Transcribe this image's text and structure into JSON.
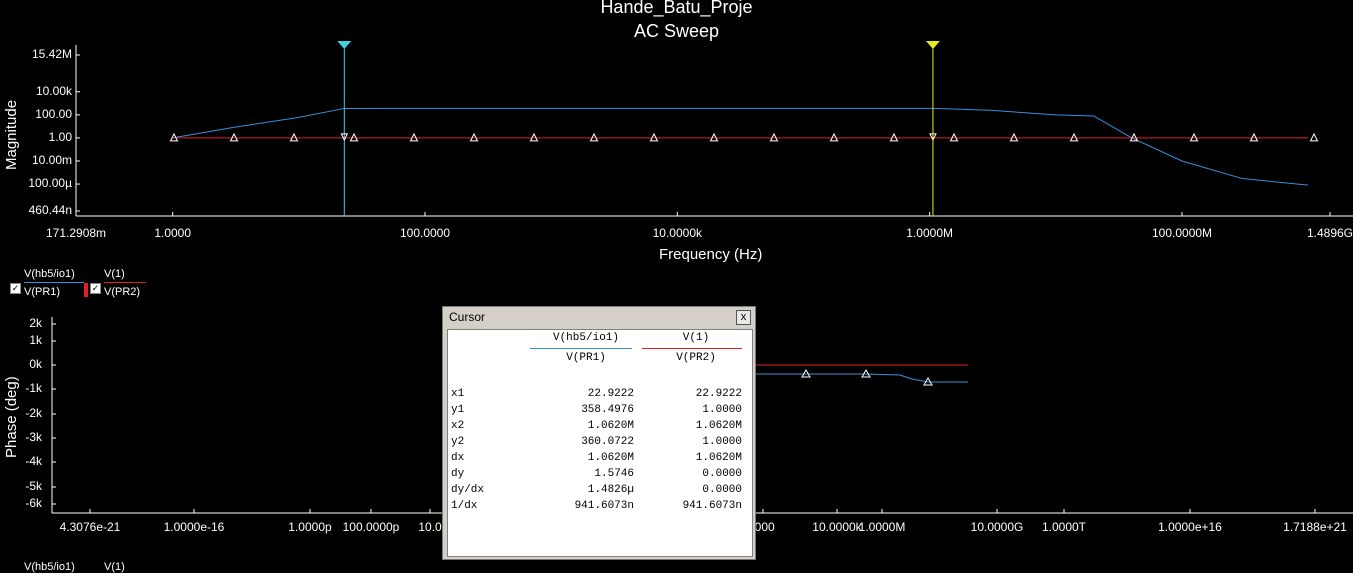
{
  "header": {
    "title": "Hande_Batu_Proje",
    "subtitle": "AC Sweep"
  },
  "colors": {
    "background": "#000000",
    "trace_blue": "#3a8fd8",
    "trace_red": "#e02020",
    "cursor1": "#40d0e0",
    "cursor2": "#e8e820"
  },
  "chart_data": [
    {
      "type": "line",
      "ylabel": "Magnitude",
      "xlabel": "Frequency (Hz)",
      "x_scale": "log",
      "y_scale": "log",
      "xlim": [
        0.1712908,
        1489600000
      ],
      "ylim": [
        4.6044e-07,
        15420000
      ],
      "x_ticks": [
        "171.2908m",
        "1.0000",
        "100.0000",
        "10.0000k",
        "1.0000M",
        "100.0000M",
        "1.4896G"
      ],
      "x_tick_values": [
        0.1712908,
        1,
        100,
        10000,
        1000000,
        100000000,
        1489600000
      ],
      "y_ticks": [
        "15.42M",
        "10.00k",
        "100.00",
        "1.00",
        "10.00m",
        "100.00µ",
        "460.44n"
      ],
      "y_tick_values": [
        15420000,
        10000,
        100,
        1,
        0.01,
        0.0001,
        4.6044e-07
      ],
      "series": [
        {
          "name": "V(hb5/io1)/V(PR1)",
          "color": "#3a8fd8",
          "x": [
            1,
            3,
            10,
            22.9222,
            100,
            1000,
            10000,
            100000,
            1062000,
            3000000,
            10000000,
            20000000,
            40000000,
            100000000,
            300000000,
            1000000000
          ],
          "y": [
            1,
            8,
            60,
            358.5,
            360,
            360,
            360,
            360,
            360,
            250,
            100,
            80,
            1,
            0.01,
            0.0003,
            8e-05
          ]
        },
        {
          "name": "V(1)/V(PR2)",
          "color": "#e02020",
          "x": [
            1,
            1000000000
          ],
          "y": [
            1,
            1
          ]
        }
      ],
      "cursors": [
        {
          "label": "1",
          "x": 22.9222,
          "color": "#40d0e0"
        },
        {
          "label": "2",
          "x": 1062000,
          "color": "#e8e820"
        }
      ]
    },
    {
      "type": "line",
      "ylabel": "Phase (deg)",
      "x_scale": "log",
      "xlim": [
        4.3076e-21,
        1.7188e+21
      ],
      "ylim": [
        -6000,
        2000
      ],
      "x_ticks": [
        "4.3076e-21",
        "1.0000e-16",
        "1.0000p",
        "100.0000p",
        "10.0",
        ".000",
        "10.0000k",
        "1.0000M",
        "10.0000G",
        "1.0000T",
        "1.0000e+16",
        "1.7188e+21"
      ],
      "y_ticks": [
        "2k",
        "1k",
        "0k",
        "-1k",
        "-2k",
        "-3k",
        "-4k",
        "-5k",
        "-6k"
      ],
      "series": [
        {
          "name": "V(hb5/io1)/V(PR1)",
          "color": "#3a8fd8"
        },
        {
          "name": "V(1)/V(PR2)",
          "color": "#e02020"
        }
      ]
    }
  ],
  "legend": {
    "items": [
      {
        "top": "V(hb5/io1)",
        "bottom": "V(PR1)",
        "color": "#3a8fd8"
      },
      {
        "top": "V(1)",
        "bottom": "V(PR2)",
        "color": "#e02020"
      }
    ]
  },
  "bottom_legend": {
    "a": "V(hb5/io1)",
    "b": "V(1)"
  },
  "cursor_window": {
    "title": "Cursor",
    "close": "x",
    "col1_top": "V(hb5/io1)",
    "col1_bottom": "V(PR1)",
    "col2_top": "V(1)",
    "col2_bottom": "V(PR2)",
    "rows": [
      {
        "k": "x1",
        "v1": "22.9222",
        "v2": "22.9222"
      },
      {
        "k": "y1",
        "v1": "358.4976",
        "v2": "1.0000"
      },
      {
        "k": "x2",
        "v1": "1.0620M",
        "v2": "1.0620M"
      },
      {
        "k": "y2",
        "v1": "360.0722",
        "v2": "1.0000"
      },
      {
        "k": "dx",
        "v1": "1.0620M",
        "v2": "1.0620M"
      },
      {
        "k": "dy",
        "v1": "1.5746",
        "v2": "0.0000"
      },
      {
        "k": "dy/dx",
        "v1": "1.4826µ",
        "v2": "0.0000"
      },
      {
        "k": "1/dx",
        "v1": "941.6073n",
        "v2": "941.6073n"
      }
    ]
  }
}
